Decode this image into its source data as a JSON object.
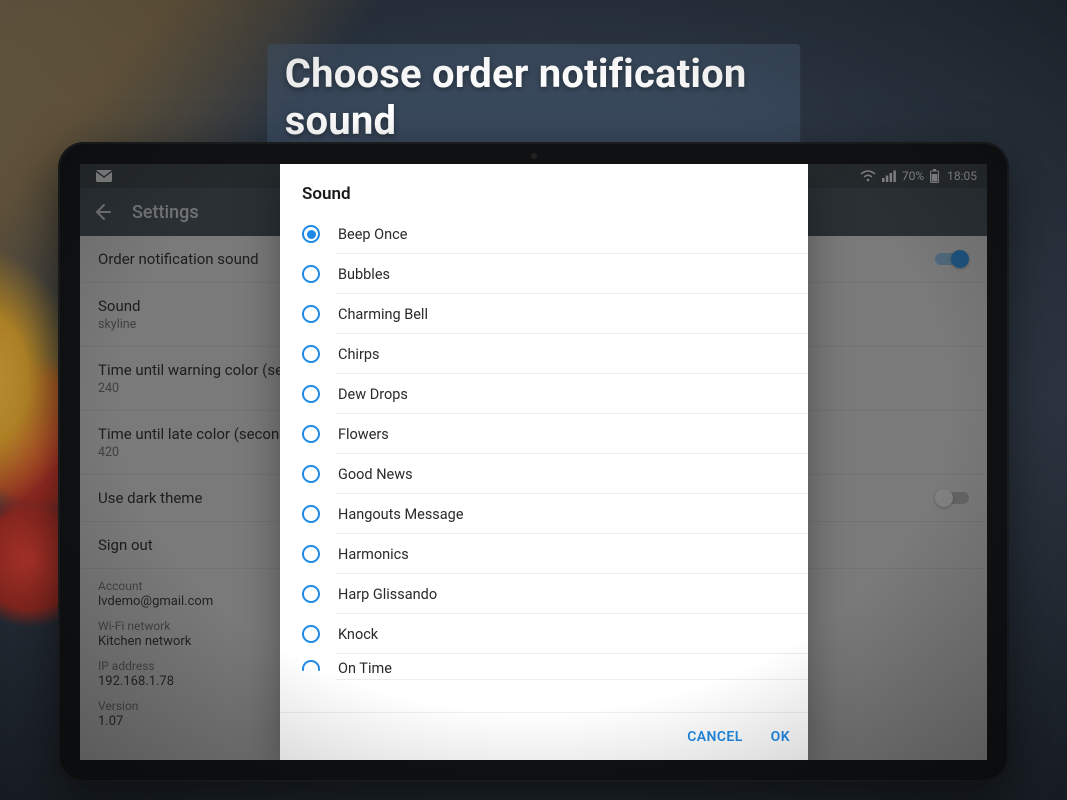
{
  "banner": "Choose order notification sound",
  "statusbar": {
    "battery_pct": "70%",
    "time": "18:05"
  },
  "appbar": {
    "title": "Settings"
  },
  "settings": {
    "order_sound": {
      "label": "Order notification sound",
      "on": true
    },
    "sound": {
      "label": "Sound",
      "value": "skyline"
    },
    "warn": {
      "label": "Time until warning color (seconds)",
      "value": "240"
    },
    "late": {
      "label": "Time until late color (seconds)",
      "value": "420"
    },
    "dark": {
      "label": "Use dark theme",
      "on": false
    },
    "signout": {
      "label": "Sign out"
    }
  },
  "info": {
    "account": {
      "label": "Account",
      "value": "lvdemo@gmail.com"
    },
    "wifi": {
      "label": "Wi-Fi network",
      "value": "Kitchen network"
    },
    "ip": {
      "label": "IP address",
      "value": "192.168.1.78"
    },
    "version": {
      "label": "Version",
      "value": "1.07"
    }
  },
  "dialog": {
    "title": "Sound",
    "selected": 0,
    "options": [
      "Beep Once",
      "Bubbles",
      "Charming Bell",
      "Chirps",
      "Dew Drops",
      "Flowers",
      "Good News",
      "Hangouts Message",
      "Harmonics",
      "Harp Glissando",
      "Knock",
      "On Time"
    ],
    "cancel": "CANCEL",
    "ok": "OK"
  }
}
